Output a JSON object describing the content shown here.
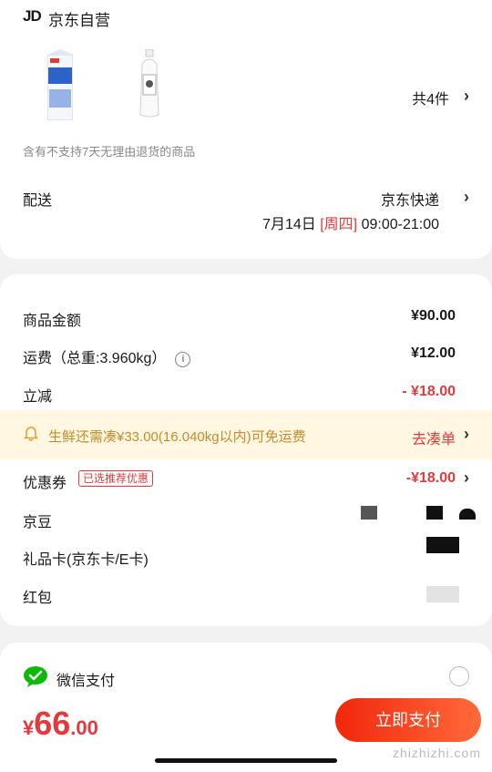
{
  "store": {
    "logo": "JD",
    "name": "京东自营"
  },
  "products": {
    "count_text": "共4件",
    "products": [
      "milk-carton",
      "milk-bottle"
    ]
  },
  "notice": "含有不支持7天无理由退货的商品",
  "shipping": {
    "label": "配送",
    "carrier": "京东快递",
    "date": "7月14日",
    "weekday": "[周四]",
    "time": "09:00-21:00"
  },
  "summary": {
    "goods_label": "商品金额",
    "goods_value": "¥90.00",
    "freight_label": "运费（总重:3.960kg）",
    "freight_value": "¥12.00",
    "discount_label": "立减",
    "discount_value": "- ¥18.00"
  },
  "banner": {
    "text": "生鲜还需凑¥33.00(16.040kg以内)可免运费",
    "action": "去凑单"
  },
  "coupon": {
    "label": "优惠券",
    "badge": "已选推荐优惠",
    "value": "-¥18.00"
  },
  "jingdou": {
    "label": "京豆"
  },
  "giftcard": {
    "label": "礼品卡(京东卡/E卡)"
  },
  "redpacket": {
    "label": "红包"
  },
  "payment": {
    "method": "微信支付"
  },
  "footer": {
    "currency": "¥",
    "amount_int": "66",
    "amount_dec": ".00",
    "pay_button": "立即支付",
    "watermark": "zhizhizhi.com"
  },
  "colors": {
    "accent": "#e4393c",
    "wechat": "#09bb07",
    "banner_bg": "#fff7e1"
  }
}
